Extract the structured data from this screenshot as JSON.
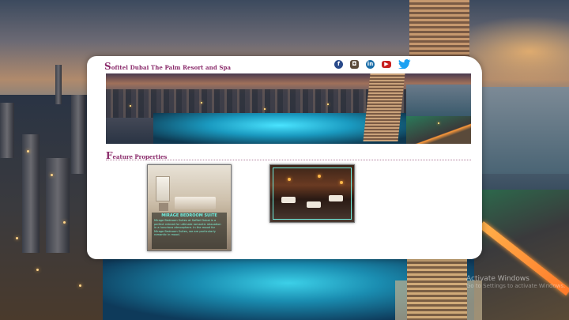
{
  "site": {
    "title_initial": "S",
    "title_rest": "ofitel Dubai The Palm Resort and Spa"
  },
  "social": [
    {
      "name": "facebook-icon",
      "glyph": "f"
    },
    {
      "name": "instagram-icon",
      "glyph": "◘"
    },
    {
      "name": "linkedin-icon",
      "glyph": "in"
    },
    {
      "name": "youtube-icon",
      "glyph": "▶"
    },
    {
      "name": "twitter-icon",
      "glyph": "🐦"
    }
  ],
  "section": {
    "title_initial": "F",
    "title_rest": "eature Properties"
  },
  "properties": [
    {
      "heading": "MIRAGE BEDROOM SUITE",
      "text": "Mirage Bedroom Suites at Sofitel Dubai is a perfect retreat for ultimate romantic relaxation in a luxurious atmosphere. In the mood for Mirage Bedroom Suites, we are particularly romantic in mood."
    },
    {
      "heading": "",
      "text": ""
    }
  ],
  "watermark": {
    "line1": "Activate Windows",
    "line2": "Go to Settings to activate Windows."
  },
  "colors": {
    "accent": "#8a2a6a",
    "caption": "#6ff0e0"
  }
}
